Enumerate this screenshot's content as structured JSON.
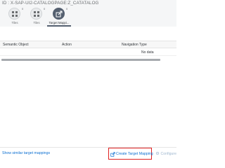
{
  "header": {
    "title": "ID : X-SAP-UI2-CATALOGPAGE:Z_CATATALOG"
  },
  "tabs": [
    {
      "label": "Tiles",
      "count": "0",
      "icon": "grid-icon"
    },
    {
      "label": "Tiles",
      "count": "0",
      "icon": "grid-icon"
    },
    {
      "label": "Target Mappi...",
      "count": "0",
      "icon": "target-mapping-icon",
      "selected": true
    }
  ],
  "table": {
    "columns": [
      "Semantic Object",
      "Action",
      "Navigation Type"
    ],
    "no_data": "No data"
  },
  "footer": {
    "show_similar": "Show similar target mappings",
    "create": "Create Target Mapping",
    "configure": "Configure"
  },
  "colors": {
    "accent": "#0a6ed1",
    "highlight": "#e02020",
    "tab_selected": "#556070"
  }
}
